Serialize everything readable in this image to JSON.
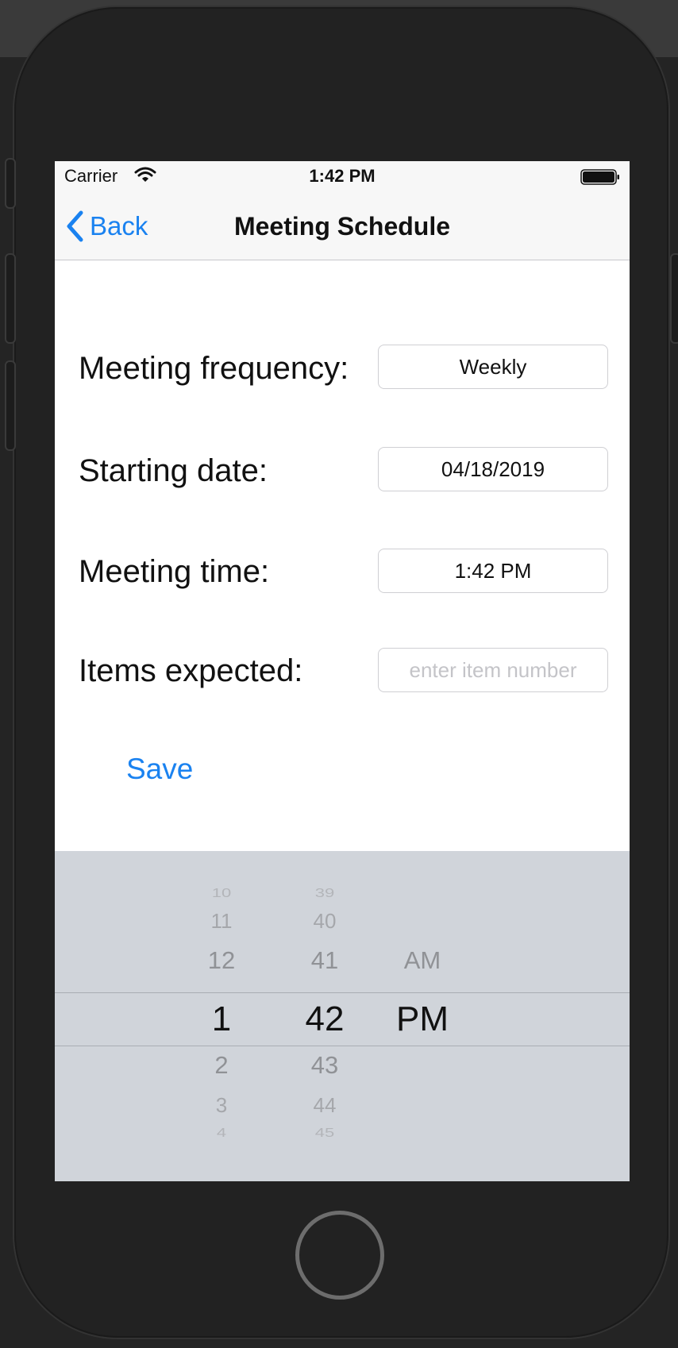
{
  "status_bar": {
    "carrier": "Carrier",
    "time": "1:42 PM",
    "wifi_icon": "wifi-icon",
    "battery_icon": "battery-icon"
  },
  "nav": {
    "back_label": "Back",
    "title": "Meeting Schedule"
  },
  "form": {
    "frequency_label": "Meeting frequency:",
    "frequency_value": "Weekly",
    "start_date_label": "Starting date:",
    "start_date_value": "04/18/2019",
    "time_label": "Meeting time:",
    "time_value": "1:42 PM",
    "items_label": "Items expected:",
    "items_placeholder": "enter item number",
    "items_value": ""
  },
  "save_label": "Save",
  "picker": {
    "hours": [
      "10",
      "11",
      "12",
      "1",
      "2",
      "3",
      "4"
    ],
    "minutes": [
      "39",
      "40",
      "41",
      "42",
      "43",
      "44",
      "45"
    ],
    "ampm": [
      "AM",
      "PM"
    ],
    "selected": {
      "hour": "1",
      "minute": "42",
      "ampm": "PM"
    }
  },
  "colors": {
    "accent": "#1a82f0",
    "picker_bg": "#d0d4da",
    "bar_bg": "#f7f7f7"
  }
}
